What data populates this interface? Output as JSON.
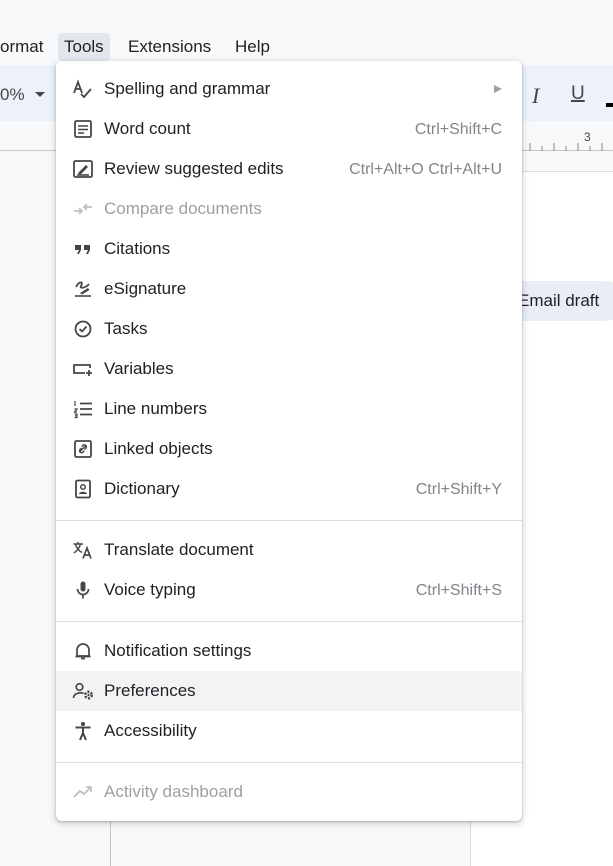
{
  "menubar": {
    "items": [
      {
        "label": "ormat"
      },
      {
        "label": "Tools"
      },
      {
        "label": "Extensions"
      },
      {
        "label": "Help"
      }
    ]
  },
  "toolbar": {
    "zoom_value": "0%",
    "italic_label": "I",
    "underline_label": "U"
  },
  "ruler": {
    "number": "3"
  },
  "document": {
    "chip_label": "Email draft"
  },
  "tools_menu": {
    "items": [
      {
        "label": "Spelling and grammar",
        "icon": "spellcheck-icon",
        "submenu": true
      },
      {
        "label": "Word count",
        "icon": "word-count-icon",
        "shortcut": "Ctrl+Shift+C"
      },
      {
        "label": "Review suggested edits",
        "icon": "review-edits-icon",
        "shortcut": "Ctrl+Alt+O Ctrl+Alt+U"
      },
      {
        "label": "Compare documents",
        "icon": "compare-icon",
        "disabled": true
      },
      {
        "label": "Citations",
        "icon": "quote-icon"
      },
      {
        "label": "eSignature",
        "icon": "signature-icon"
      },
      {
        "label": "Tasks",
        "icon": "task-check-icon"
      },
      {
        "label": "Variables",
        "icon": "variables-icon"
      },
      {
        "label": "Line numbers",
        "icon": "line-numbers-icon"
      },
      {
        "label": "Linked objects",
        "icon": "linked-objects-icon"
      },
      {
        "label": "Dictionary",
        "icon": "dictionary-icon",
        "shortcut": "Ctrl+Shift+Y"
      },
      {
        "label": "Translate document",
        "icon": "translate-icon"
      },
      {
        "label": "Voice typing",
        "icon": "microphone-icon",
        "shortcut": "Ctrl+Shift+S"
      },
      {
        "label": "Notification settings",
        "icon": "bell-icon"
      },
      {
        "label": "Preferences",
        "icon": "preferences-icon",
        "highlighted": true
      },
      {
        "label": "Accessibility",
        "icon": "accessibility-icon"
      },
      {
        "label": "Activity dashboard",
        "icon": "trending-up-icon",
        "disabled": true
      }
    ]
  },
  "colors": {
    "menu_background": "#ffffff",
    "highlight": "#f1f3f4",
    "toolbar_background": "#edf2fa",
    "disabled_text": "#9aa0a6",
    "shortcut_text": "#80868b"
  }
}
